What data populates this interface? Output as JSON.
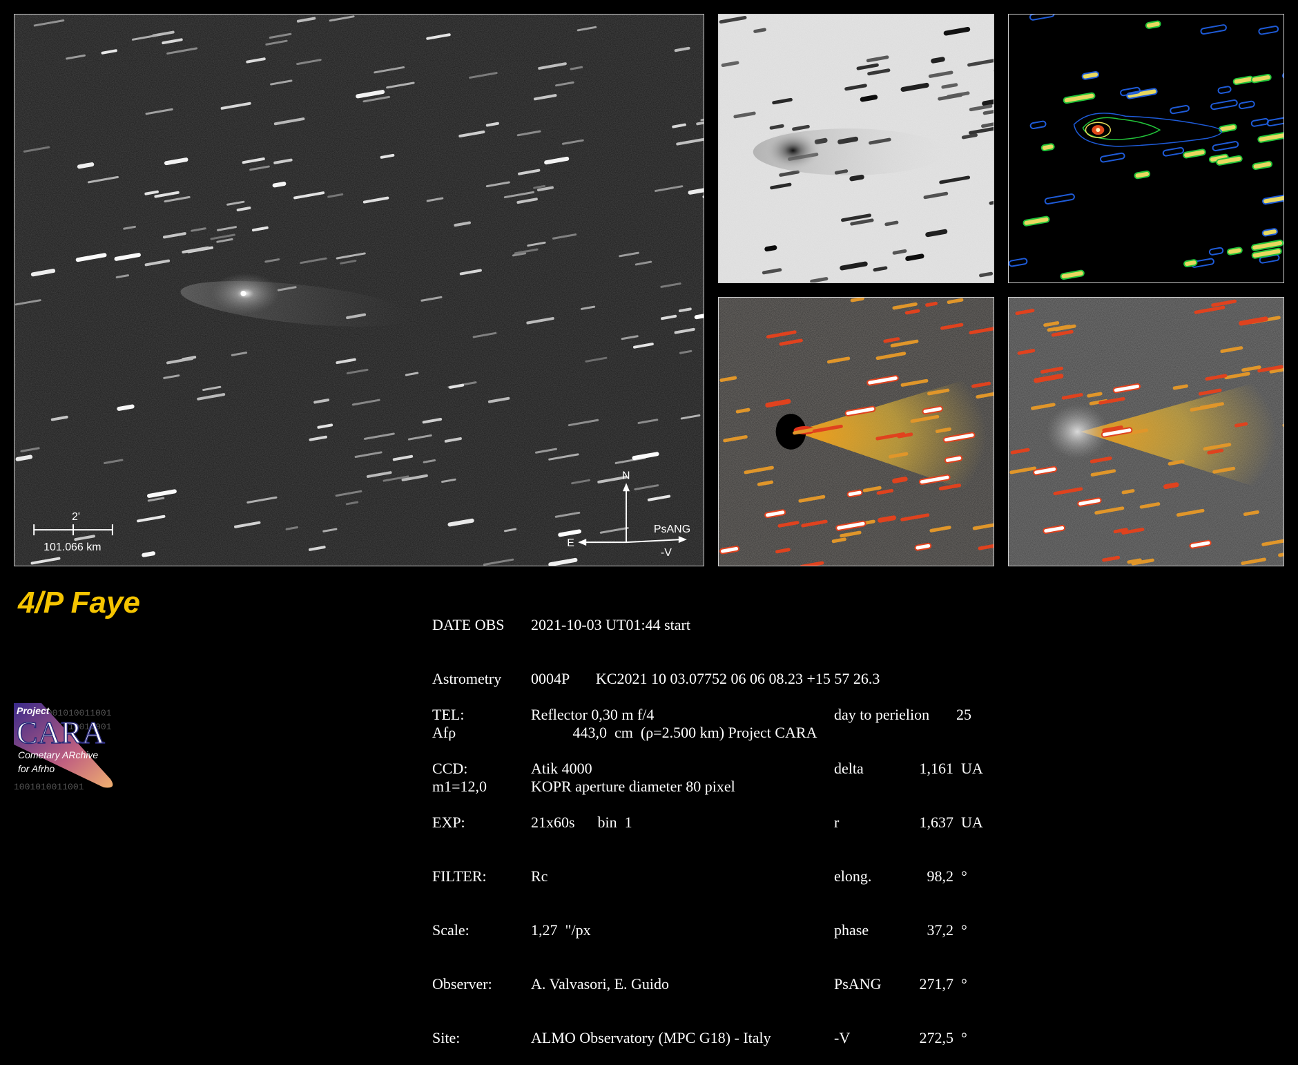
{
  "title": "4/P Faye",
  "main_image": {
    "scale_bar": {
      "angle_label": "2'",
      "distance_label": "101.066 km"
    },
    "compass": {
      "north": "N",
      "east": "E",
      "psang": "PsANG",
      "minus_v": "-V"
    }
  },
  "observation": [
    {
      "label": "DATE OBS",
      "value": "2021-10-03 UT01:44 start"
    },
    {
      "label": "Astrometry",
      "value": "0004P       KC2021 10 03.07752 06 06 08.23 +15 57 26.3"
    },
    {
      "label": "Afρ",
      "value": "           443,0  cm  (ρ=2.500 km) Project CARA"
    },
    {
      "label": "m1=12,0",
      "value": "KOPR aperture diameter 80 pixel"
    }
  ],
  "setup": [
    {
      "label": "TEL:",
      "value": "Reflector 0,30 m f/4"
    },
    {
      "label": "CCD:",
      "value": "Atik 4000"
    },
    {
      "label": "EXP:",
      "value": "21x60s      bin  1"
    },
    {
      "label": "FILTER:",
      "value": "Rc"
    },
    {
      "label": "Scale:",
      "value": "1,27  \"/px"
    },
    {
      "label": "Observer:",
      "value": "A. Valvasori, E. Guido"
    },
    {
      "label": "Site:",
      "value": "ALMO Observatory (MPC G18) - Italy"
    }
  ],
  "geometry": [
    {
      "label": "day to perielion",
      "value": "25"
    },
    {
      "label": "delta",
      "value": "     1,161  UA"
    },
    {
      "label": "r",
      "value": "     1,637  UA"
    },
    {
      "label": "elong.",
      "value": "       98,2  °"
    },
    {
      "label": "phase",
      "value": "       37,2  °"
    },
    {
      "label": "PsANG",
      "value": "     271,7  °"
    },
    {
      "label": "-V",
      "value": "     272,5  °"
    }
  ],
  "logo": {
    "project": "Project",
    "name": "CARA",
    "line1": "Cometary ARchive",
    "line2": "for Afrho",
    "binary": "1001010011001"
  },
  "colors": {
    "title": "#f5c400",
    "panel_border": "#cfcfcf"
  }
}
